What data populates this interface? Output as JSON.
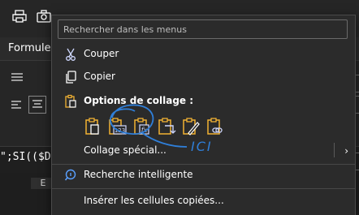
{
  "ribbon": {
    "tab_label": "Formules",
    "formula_text": "\";SI(($D",
    "column_header": "E"
  },
  "menu": {
    "search_placeholder": "Rechercher dans les menus",
    "items": {
      "cut": "Couper",
      "copy": "Copier",
      "paste_options": "Options de collage :",
      "paste_special": "Collage spécial...",
      "smart_lookup": "Recherche intelligente",
      "insert_copied": "Insérer les cellules copiées..."
    },
    "paste_buttons": [
      "paste-icon",
      "paste-values-icon",
      "paste-formulas-icon",
      "paste-transpose-icon",
      "paste-formatting-icon",
      "paste-link-icon"
    ]
  },
  "annotation": {
    "text": "ICI",
    "color": "#2f7fd9"
  },
  "colors": {
    "accent": "#f2b233",
    "menu_bg": "#2b2b2b"
  }
}
